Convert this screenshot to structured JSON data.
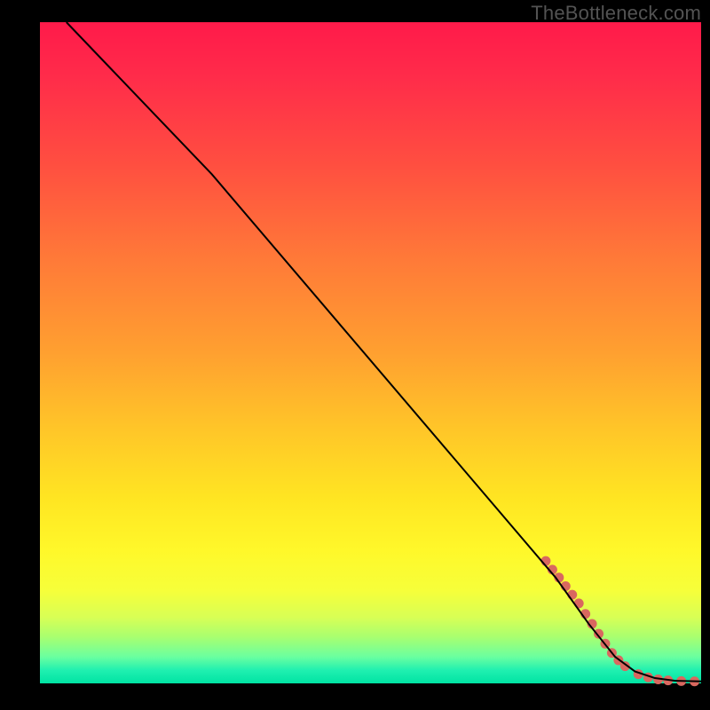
{
  "watermark": "TheBottleneck.com",
  "chart_data": {
    "type": "line",
    "title": "",
    "xlabel": "",
    "ylabel": "",
    "xlim": [
      0,
      100
    ],
    "ylim": [
      0,
      100
    ],
    "grid": false,
    "legend": false,
    "gradient_stops": [
      {
        "pos": 0.0,
        "color": "#ff1a4a"
      },
      {
        "pos": 0.08,
        "color": "#ff2b4a"
      },
      {
        "pos": 0.22,
        "color": "#ff5040"
      },
      {
        "pos": 0.36,
        "color": "#ff7a38"
      },
      {
        "pos": 0.5,
        "color": "#ffa030"
      },
      {
        "pos": 0.62,
        "color": "#ffc728"
      },
      {
        "pos": 0.72,
        "color": "#ffe522"
      },
      {
        "pos": 0.8,
        "color": "#fff82a"
      },
      {
        "pos": 0.86,
        "color": "#f6ff3a"
      },
      {
        "pos": 0.9,
        "color": "#d8ff55"
      },
      {
        "pos": 0.93,
        "color": "#a8ff70"
      },
      {
        "pos": 0.96,
        "color": "#6affa0"
      },
      {
        "pos": 0.98,
        "color": "#20f0b0"
      },
      {
        "pos": 1.0,
        "color": "#00e3a3"
      }
    ],
    "series": [
      {
        "name": "curve-black",
        "color": "#000000",
        "stroke_width": 2,
        "points": [
          {
            "x": 4.0,
            "y": 100.0
          },
          {
            "x": 26.0,
            "y": 77.0
          },
          {
            "x": 78.0,
            "y": 16.0
          },
          {
            "x": 83.0,
            "y": 9.0
          },
          {
            "x": 87.0,
            "y": 4.0
          },
          {
            "x": 90.0,
            "y": 1.8
          },
          {
            "x": 93.0,
            "y": 0.8
          },
          {
            "x": 96.0,
            "y": 0.4
          },
          {
            "x": 100.0,
            "y": 0.3
          }
        ]
      }
    ],
    "markers": {
      "name": "highlight-dots",
      "color": "#d9685f",
      "radius": 5.5,
      "points": [
        {
          "x": 76.5,
          "y": 18.5
        },
        {
          "x": 77.5,
          "y": 17.2
        },
        {
          "x": 78.5,
          "y": 16.0
        },
        {
          "x": 79.5,
          "y": 14.7
        },
        {
          "x": 80.5,
          "y": 13.4
        },
        {
          "x": 81.5,
          "y": 12.1
        },
        {
          "x": 82.5,
          "y": 10.5
        },
        {
          "x": 83.5,
          "y": 9.0
        },
        {
          "x": 84.5,
          "y": 7.5
        },
        {
          "x": 85.5,
          "y": 6.0
        },
        {
          "x": 86.5,
          "y": 4.6
        },
        {
          "x": 87.5,
          "y": 3.5
        },
        {
          "x": 88.5,
          "y": 2.6
        },
        {
          "x": 90.5,
          "y": 1.4
        },
        {
          "x": 92.0,
          "y": 0.9
        },
        {
          "x": 93.5,
          "y": 0.6
        },
        {
          "x": 95.0,
          "y": 0.45
        },
        {
          "x": 97.0,
          "y": 0.35
        },
        {
          "x": 99.0,
          "y": 0.3
        }
      ]
    }
  }
}
